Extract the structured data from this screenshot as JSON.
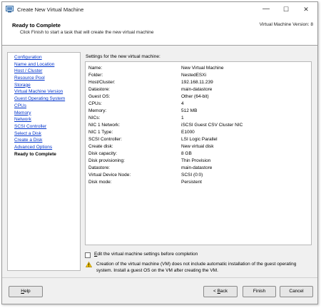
{
  "window": {
    "title": "Create New Virtual Machine",
    "controls": {
      "minimize": "—",
      "maximize": "☐",
      "close": "✕"
    }
  },
  "header": {
    "title": "Ready to Complete",
    "subtitle": "Click Finish to start a task that will create the new virtual machine",
    "version": "Virtual Machine Version: 8"
  },
  "steps": [
    {
      "label": "Configuration"
    },
    {
      "label": "Name and Location"
    },
    {
      "label": "Host / Cluster"
    },
    {
      "label": "Resource Pool"
    },
    {
      "label": "Storage"
    },
    {
      "label": "Virtual Machine Version"
    },
    {
      "label": "Guest Operating System"
    },
    {
      "label": "CPUs"
    },
    {
      "label": "Memory"
    },
    {
      "label": "Network"
    },
    {
      "label": "SCSI Controller"
    },
    {
      "label": "Select a Disk"
    },
    {
      "label": "Create a Disk"
    },
    {
      "label": "Advanced Options"
    },
    {
      "label": "Ready to Complete",
      "current": true
    }
  ],
  "settings": {
    "label": "Settings for the new virtual machine:",
    "rows": [
      {
        "k": "Name:",
        "v": "New Virtual Machine"
      },
      {
        "k": "Folder:",
        "v": "NestedESXi"
      },
      {
        "k": "Host/Cluster:",
        "v": "192.168.11.239"
      },
      {
        "k": "Datastore:",
        "v": "main-datastore"
      },
      {
        "k": "Guest OS:",
        "v": "Other (64-bit)"
      },
      {
        "k": "CPUs:",
        "v": "4"
      },
      {
        "k": "Memory:",
        "v": "512 MB"
      },
      {
        "k": "NICs:",
        "v": "1"
      },
      {
        "k": "NIC 1 Network:",
        "v": "iSCSI Guest CSV Cluster NIC"
      },
      {
        "k": "NIC 1 Type:",
        "v": "E1000"
      },
      {
        "k": "SCSI Controller:",
        "v": "LSI Logic Parallel"
      },
      {
        "k": "Create disk:",
        "v": "New virtual disk"
      },
      {
        "k": "Disk capacity:",
        "v": "8 GB"
      },
      {
        "k": "Disk provisioning:",
        "v": "Thin Provision"
      },
      {
        "k": "Datastore:",
        "v": "main-datastore"
      },
      {
        "k": "Virtual Device Node:",
        "v": "SCSI (0:0)"
      },
      {
        "k": "Disk mode:",
        "v": "Persistent"
      }
    ]
  },
  "edit_checkbox": {
    "label": "Edit the virtual machine settings before completion",
    "checked": false
  },
  "warning": {
    "icon": "warning-icon",
    "text": "Creation of the virtual machine (VM) does not include automatic installation of the guest operating system. Install a guest OS on the VM after creating the VM."
  },
  "buttons": {
    "help": "Help",
    "back": "< Back",
    "finish": "Finish",
    "cancel": "Cancel"
  },
  "colors": {
    "link": "#0033cc",
    "warning": "#f2c200"
  }
}
